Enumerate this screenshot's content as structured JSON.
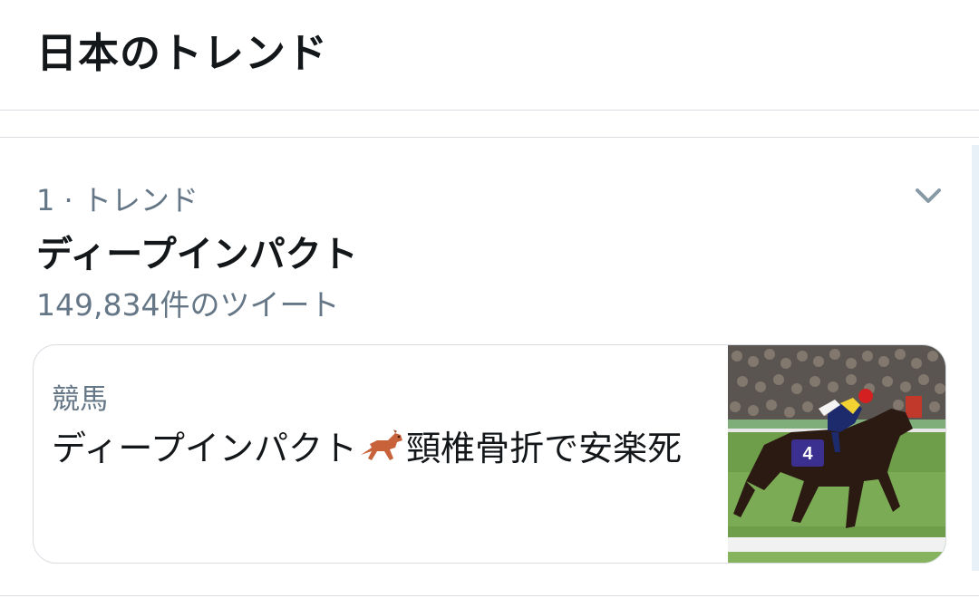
{
  "header": {
    "title": "日本のトレンド"
  },
  "trend": {
    "meta": "1 · トレンド",
    "name": "ディープインパクト",
    "count": "149,834件のツイート",
    "menu_icon": "chevron-down-icon"
  },
  "card": {
    "category": "競馬",
    "headline_before": "ディープインパクト",
    "emoji": "horse-racing-emoji",
    "headline_after": "頸椎骨折で安楽死",
    "image": "racehorse-photo",
    "image_bib_number": "4"
  },
  "colors": {
    "text_primary": "#14171a",
    "text_secondary": "#657786",
    "divider": "#d9dde1",
    "accent_light": "#e8f1f8"
  }
}
